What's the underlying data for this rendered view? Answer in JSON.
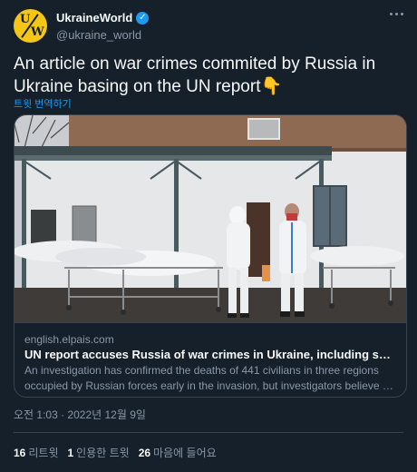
{
  "author": {
    "name": "UkraineWorld",
    "handle": "@ukraine_world",
    "avatar_letters": [
      "U",
      "W"
    ],
    "verified_icon": "verified-badge-icon"
  },
  "tweet": {
    "text": "An article on war crimes commited by Russia in Ukraine basing on the UN report👇",
    "translate_label": "트윗 번역하기",
    "timestamp": "오전 1:03 · 2022년 12월 9일"
  },
  "card": {
    "domain": "english.elpais.com",
    "title": "UN report accuses Russia of war crimes in Ukraine, including summary executi…",
    "description_line1": "An investigation has confirmed the deaths of 441 civilians in three regions",
    "description_line2": "occupied by Russian forces early in the invasion, but investigators believe there…"
  },
  "stats": {
    "retweets_count": "16",
    "retweets_label": "리트윗",
    "quotes_count": "1",
    "quotes_label": "인용한 트윗",
    "likes_count": "26",
    "likes_label": "마음에 들어요"
  },
  "colors": {
    "background": "#15202b",
    "accent": "#1d9bf0",
    "muted": "#8b98a5",
    "border": "#38444d"
  }
}
